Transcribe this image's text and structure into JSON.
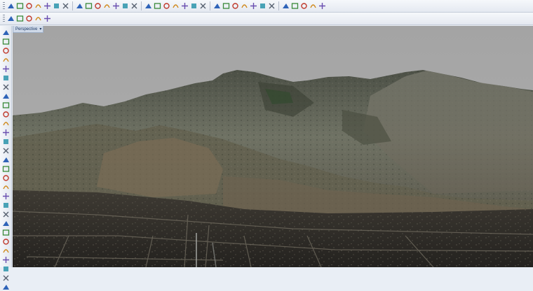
{
  "viewport": {
    "title": "Perspective",
    "menu_arrow": "▾"
  },
  "toolbars": {
    "standard": [
      "new-icon",
      "open-icon",
      "undo-icon",
      "redo-icon",
      "cut-icon",
      "copy-icon",
      "paste-icon",
      "pan-icon",
      "rotate-icon",
      "zoom-icon",
      "zoom-window-icon",
      "zoom-extents-icon",
      "zoom-selected-icon",
      "select-icon",
      "grid-icon",
      "layout-icon",
      "layer-icon",
      "properties-icon",
      "render-icon",
      "snap-icon",
      "point-icon",
      "curve-icon",
      "surface-icon",
      "solid-icon",
      "mesh-icon",
      "transform-icon",
      "analyze-icon",
      "dimension-icon",
      "block-icon",
      "shade-icon",
      "material-icon",
      "light-icon",
      "help-icon"
    ],
    "secondary": [
      "plugin-shield-icon",
      "plugin-save-icon",
      "plugin-warning-icon",
      "plugin-frame-icon",
      "plugin-paint-icon"
    ],
    "left": [
      "point-tool-icon",
      "line-tool-icon",
      "polyline-tool-icon",
      "circle-tool-icon",
      "rectangle-tool-icon",
      "arc-tool-icon",
      "curve-tool-icon",
      "surface-tool-icon",
      "extrude-tool-icon",
      "box-tool-icon",
      "sphere-tool-icon",
      "boolean-tool-icon",
      "fillet-tool-icon",
      "trim-tool-icon",
      "split-tool-icon",
      "join-tool-icon",
      "explode-tool-icon",
      "group-tool-icon",
      "move-tool-icon",
      "copy-tool-icon",
      "rotate-tool-icon",
      "scale-tool-icon",
      "mirror-tool-icon",
      "array-tool-icon",
      "dimension-tool-icon",
      "text-tool-icon",
      "hatch-tool-icon",
      "check-tool-icon",
      "paint-tool-icon"
    ]
  },
  "colors": {
    "sky": "#a6a6a6",
    "mountain": "#5d6155",
    "ground": "#2c2a26",
    "tab_text": "#1d3a66"
  }
}
